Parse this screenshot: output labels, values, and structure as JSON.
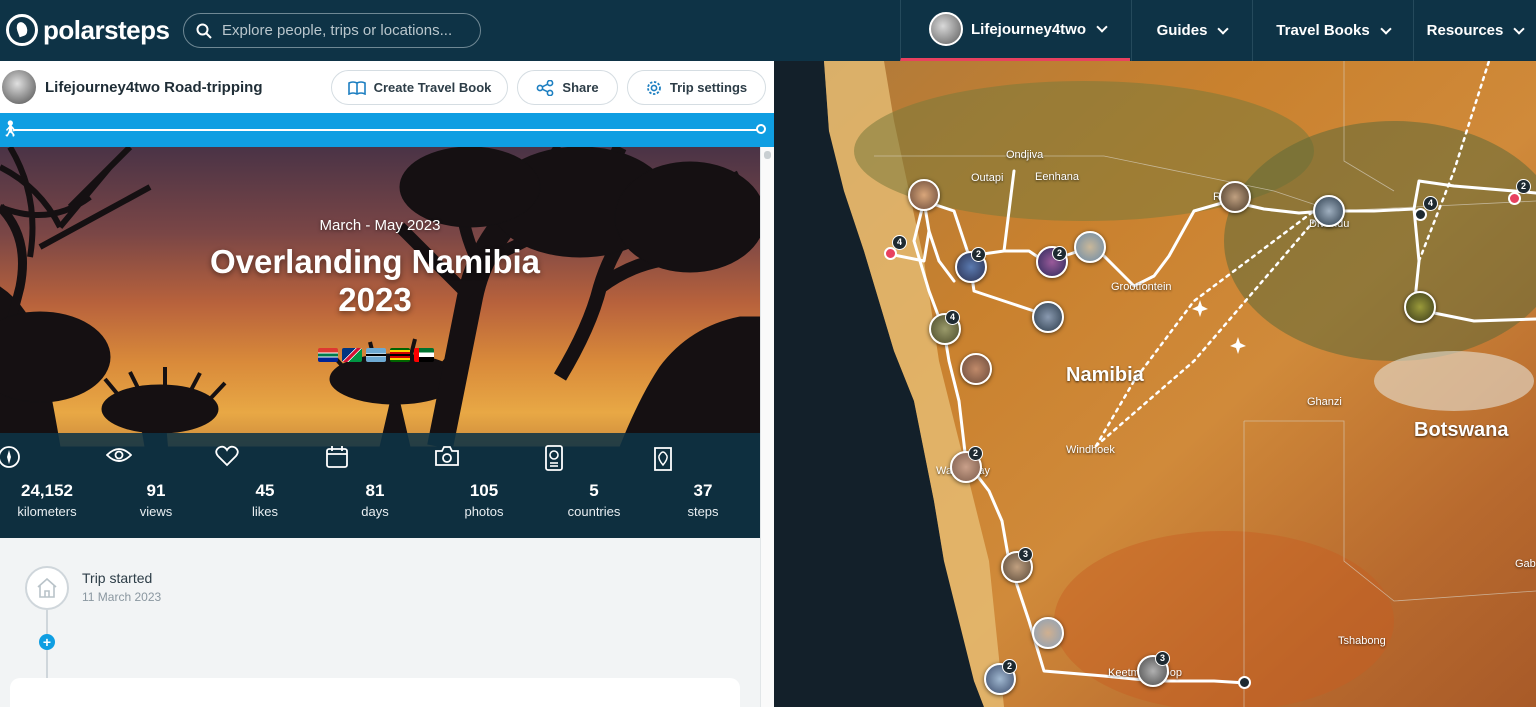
{
  "nav": {
    "logo": "polarsteps",
    "search_placeholder": "Explore people, trips or locations...",
    "user": "Lifejourney4two",
    "guides": "Guides",
    "travel_books": "Travel Books",
    "resources": "Resources"
  },
  "trip_header": {
    "owner": "Lifejourney4two Road-tripping",
    "create_book": "Create Travel Book",
    "share": "Share",
    "settings": "Trip settings"
  },
  "hero": {
    "dates": "March - May 2023",
    "title": "Overlanding Namibia 2023",
    "flags": [
      "south-africa",
      "namibia",
      "botswana",
      "zimbabwe",
      "uae"
    ]
  },
  "stats": [
    {
      "value": "24,152",
      "label": "kilometers",
      "icon": "compass-icon"
    },
    {
      "value": "91",
      "label": "views",
      "icon": "eye-icon"
    },
    {
      "value": "45",
      "label": "likes",
      "icon": "heart-icon"
    },
    {
      "value": "81",
      "label": "days",
      "icon": "calendar-icon"
    },
    {
      "value": "105",
      "label": "photos",
      "icon": "camera-icon"
    },
    {
      "value": "5",
      "label": "countries",
      "icon": "passport-icon"
    },
    {
      "value": "37",
      "label": "steps",
      "icon": "map-pin-icon"
    }
  ],
  "timeline": {
    "started_title": "Trip started",
    "started_date": "11 March 2023"
  },
  "map": {
    "countries": [
      "Namibia",
      "Botswana"
    ],
    "places": [
      "Ondjiva",
      "Outapi",
      "Eenhana",
      "Grootfontein",
      "Windhoek",
      "Ghanzi",
      "Tshabong",
      "Keetmanshoop",
      "Walvis Bay",
      "Rundu",
      "Divundu",
      "Gab"
    ],
    "badges": [
      "4",
      "2",
      "2",
      "4",
      "2",
      "3",
      "2",
      "3",
      "4",
      "2"
    ]
  },
  "colors": {
    "nav_bg": "#0e3346",
    "accent_blue": "#0f9ee2",
    "accent_red": "#e8415f"
  }
}
